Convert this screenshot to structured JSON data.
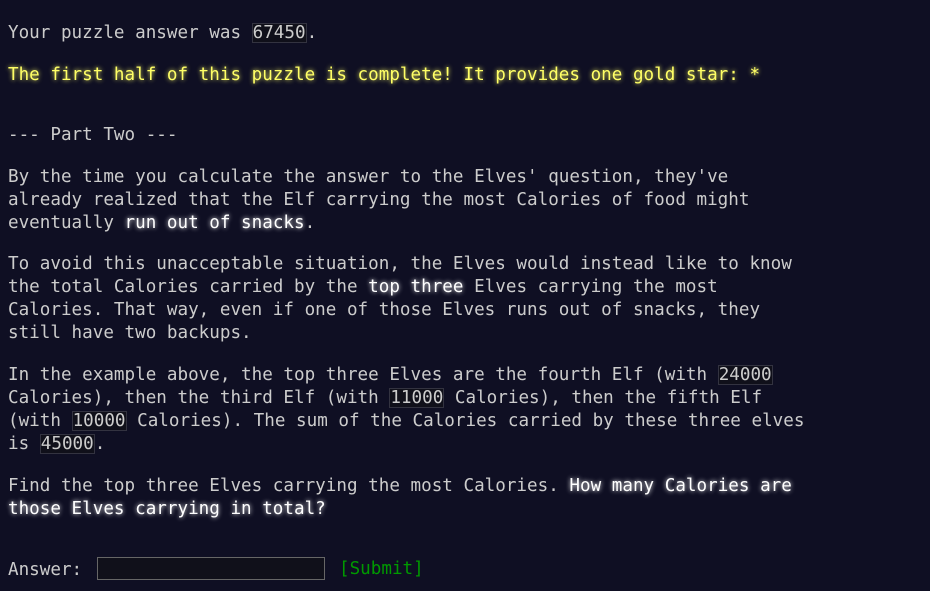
{
  "answer_line": {
    "prefix": "Your puzzle answer was ",
    "value": "67450",
    "suffix": "."
  },
  "completion": {
    "text": "The first half of this puzzle is complete! It provides one gold star: ",
    "star": "*"
  },
  "part_two_heading": "--- Part Two ---",
  "p1": {
    "l1": "By the time you calculate the answer to the Elves' question, they've",
    "l2": "already realized that the Elf carrying the most Calories of food might",
    "l3_prefix": "eventually ",
    "l3_em": "run out of snacks",
    "l3_suffix": "."
  },
  "p2": {
    "l1": "To avoid this unacceptable situation, the Elves would instead like to know",
    "l2_prefix": "the total Calories carried by the ",
    "l2_em": "top three",
    "l2_suffix": " Elves carrying the most",
    "l3": "Calories. That way, even if one of those Elves runs out of snacks, they",
    "l4": "still have two backups."
  },
  "p3": {
    "l1_prefix": "In the example above, the top three Elves are the fourth Elf (with ",
    "l1_code": "24000",
    "l2_prefix": "Calories), then the third Elf (with ",
    "l2_code": "11000",
    "l2_suffix": " Calories), then the fifth Elf",
    "l3_prefix": "(with ",
    "l3_code": "10000",
    "l3_suffix": " Calories). The sum of the Calories carried by these three elves",
    "l4_prefix": "is ",
    "l4_code": "45000",
    "l4_suffix": "."
  },
  "p4": {
    "l1_prefix": "Find the top three Elves carrying the most Calories. ",
    "l1_em": "How many Calories are",
    "l2_em": "those Elves carrying in total?"
  },
  "form": {
    "label": "Answer: ",
    "input_value": "",
    "submit_label": "[Submit]"
  },
  "colors": {
    "background": "#0f0f23",
    "text": "#cccccc",
    "gold": "#ffff66",
    "submit": "#009900",
    "emphasis": "#ffffff"
  }
}
